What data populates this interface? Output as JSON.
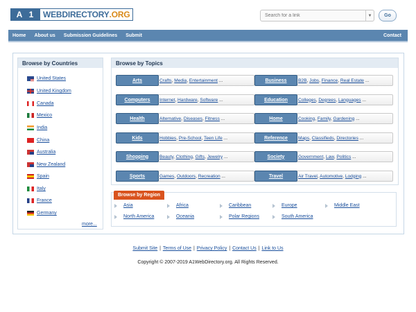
{
  "logo": {
    "prefix_a": "A",
    "prefix_1": "1",
    "word": "WEBDIRECTORY",
    "tld": ".ORG"
  },
  "search": {
    "placeholder": "Search for a link",
    "go_label": "Go",
    "dropdown_icon": "chevron-down-icon"
  },
  "nav": {
    "items": [
      "Home",
      "About us",
      "Submission Guidelines",
      "Submit"
    ],
    "right": "Contact"
  },
  "countries": {
    "title": "Browse by Countries",
    "items": [
      {
        "name": "United States",
        "flag": "us-flag-icon"
      },
      {
        "name": "United Kingdom",
        "flag": "uk-flag-icon"
      },
      {
        "name": "Canada",
        "flag": "canada-flag-icon"
      },
      {
        "name": "Mexico",
        "flag": "mexico-flag-icon"
      },
      {
        "name": "India",
        "flag": "india-flag-icon"
      },
      {
        "name": "China",
        "flag": "china-flag-icon"
      },
      {
        "name": "Australia",
        "flag": "australia-flag-icon"
      },
      {
        "name": "New Zealand",
        "flag": "new-zealand-flag-icon"
      },
      {
        "name": "Spain",
        "flag": "spain-flag-icon"
      },
      {
        "name": "Italy",
        "flag": "italy-flag-icon"
      },
      {
        "name": "France",
        "flag": "france-flag-icon"
      },
      {
        "name": "Germany",
        "flag": "germany-flag-icon"
      }
    ],
    "more": "more..."
  },
  "topics": {
    "title": "Browse by Topics",
    "items": [
      {
        "name": "Arts",
        "subs": [
          "Crafts",
          "Media",
          "Entertainment"
        ]
      },
      {
        "name": "Business",
        "subs": [
          "B2B",
          "Jobs",
          "Finance",
          "Real Estate"
        ]
      },
      {
        "name": "Computers",
        "subs": [
          "Internet",
          "Hardware",
          "Software"
        ]
      },
      {
        "name": "Education",
        "subs": [
          "Colleges",
          "Degrees",
          "Languages"
        ]
      },
      {
        "name": "Health",
        "subs": [
          "Alternative",
          "Diseases",
          "Fitness"
        ]
      },
      {
        "name": "Home",
        "subs": [
          "Cooking",
          "Family",
          "Gardening"
        ]
      },
      {
        "name": "Kids",
        "subs": [
          "Hobbies",
          "Pre-School",
          "Teen Life"
        ]
      },
      {
        "name": "Reference",
        "subs": [
          "Maps",
          "Classifieds",
          "Directories"
        ]
      },
      {
        "name": "Shopping",
        "subs": [
          "Beauty",
          "Clothing",
          "Gifts",
          "Jewelry"
        ]
      },
      {
        "name": "Society",
        "subs": [
          "Government",
          "Law",
          "Politics"
        ]
      },
      {
        "name": "Sports",
        "subs": [
          "Games",
          "Outdoors",
          "Recreation"
        ]
      },
      {
        "name": "Travel",
        "subs": [
          "Air Travel",
          "Automotive",
          "Lodging"
        ]
      }
    ],
    "ellipsis": " ..."
  },
  "region": {
    "title": "Browse by Region",
    "items": [
      "Asia",
      "Africa",
      "Caribbean",
      "Europe",
      "Middle East",
      "North America",
      "Oceania",
      "Polar Regions",
      "South America"
    ]
  },
  "footer": {
    "links": [
      "Submit Site",
      "Terms of Use",
      "Privacy Policy",
      "Contact Us",
      "Link to Us"
    ],
    "separator": "|",
    "copyright": "Copyright © 2007-2019 A1WebDirectory.org. All Rights Reserved."
  },
  "colors": {
    "nav_bg": "#5b86b0",
    "region_tab": "#d9531e",
    "link": "#1a4f9c",
    "panel_header": "#e3ebf3"
  }
}
